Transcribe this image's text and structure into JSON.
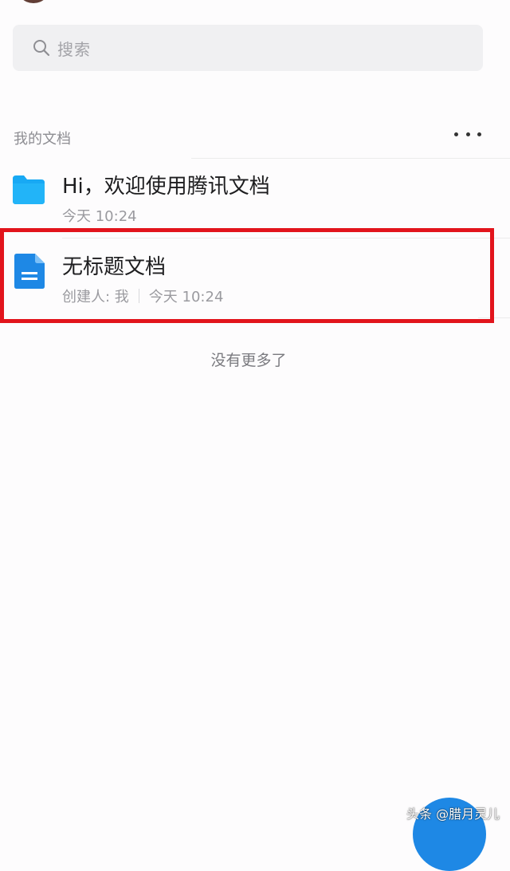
{
  "search": {
    "placeholder": "搜索",
    "icon": "search-icon"
  },
  "section": {
    "title": "我的文档",
    "more_icon": "more-horizontal-icon"
  },
  "documents": [
    {
      "icon": "folder-icon",
      "title": "Hi，欢迎使用腾讯文档",
      "time": "今天 10:24"
    },
    {
      "icon": "document-icon",
      "title": "无标题文档",
      "creator": "创建人: 我",
      "time": "今天 10:24",
      "highlighted": true
    }
  ],
  "list_end_text": "没有更多了",
  "watermark": "头条 @腊月灵儿",
  "colors": {
    "folder": "#18a9f4",
    "document": "#1e88e5",
    "highlight": "#e2141c",
    "fab": "#1e88e5"
  }
}
